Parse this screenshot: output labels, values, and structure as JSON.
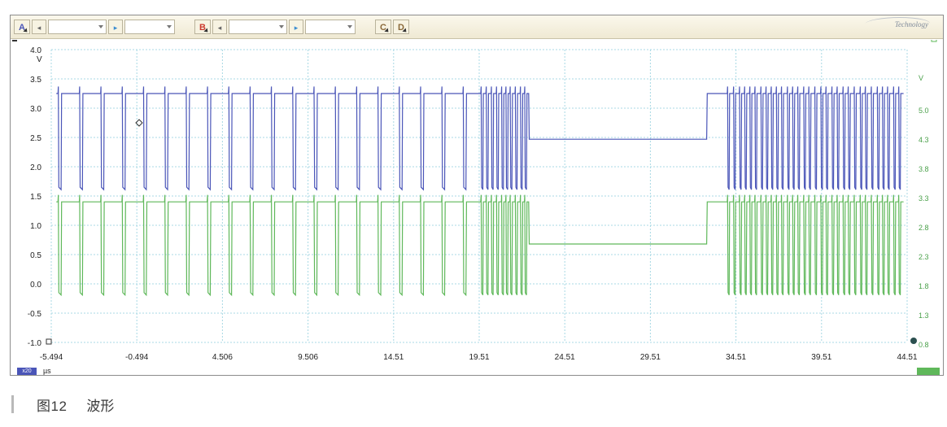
{
  "toolbar": {
    "channels": [
      {
        "label": "A",
        "color": "#4a55b8"
      },
      {
        "label": "B",
        "color": "#cc3b2f"
      },
      {
        "label": "C",
        "color": "#8b6a3a"
      },
      {
        "label": "D",
        "color": "#8b6a3a"
      }
    ],
    "brand": "Technology"
  },
  "axes": {
    "left_unit": "V",
    "left_ticks": [
      "4.0",
      "3.5",
      "3.0",
      "2.5",
      "2.0",
      "1.5",
      "1.0",
      "0.5",
      "0.0",
      "-0.5",
      "-1.0"
    ],
    "right_unit": "V",
    "right_ticks": [
      "5.0",
      "4.3",
      "3.8",
      "3.3",
      "2.8",
      "2.3",
      "1.8",
      "1.3",
      "0.8"
    ],
    "x_ticks": [
      "-5.494",
      "-0.494",
      "4.506",
      "9.506",
      "14.51",
      "19.51",
      "24.51",
      "29.51",
      "34.51",
      "39.51",
      "44.51"
    ],
    "x_unit": "µs",
    "x_range": [
      -5.494,
      44.51
    ],
    "x_badge": "x20"
  },
  "colors": {
    "channel_a": "#4a55b8",
    "channel_b": "#5fb85a",
    "grid": "#a8d8e4"
  },
  "caption": {
    "figure_number": "图12",
    "title": "波形"
  }
}
